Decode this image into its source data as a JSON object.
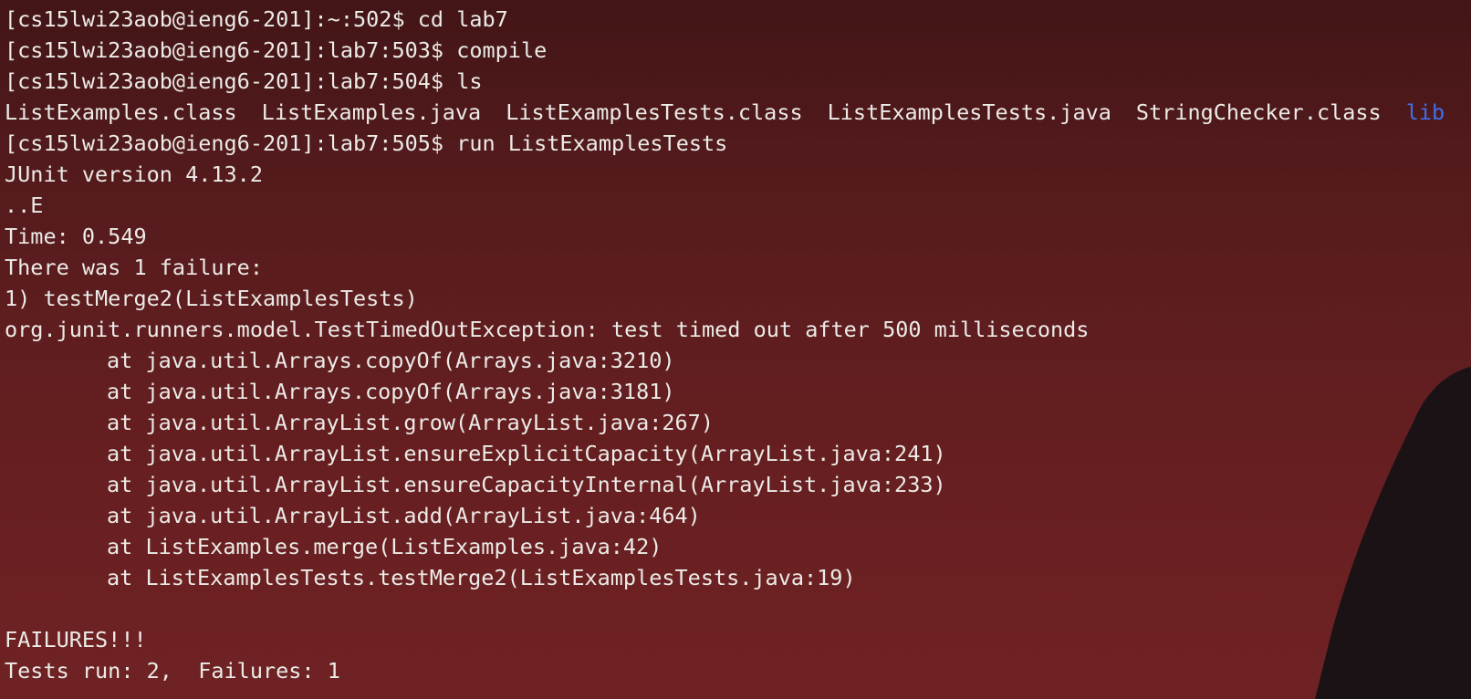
{
  "terminal": {
    "cmd1": {
      "prompt": "[cs15lwi23aob@ieng6-201]:~:502$",
      "command": "cd lab7"
    },
    "cmd2": {
      "prompt": "[cs15lwi23aob@ieng6-201]:lab7:503$",
      "command": "compile"
    },
    "cmd3": {
      "prompt": "[cs15lwi23aob@ieng6-201]:lab7:504$",
      "command": "ls"
    },
    "ls_files": [
      "ListExamples.class",
      "ListExamples.java",
      "ListExamplesTests.class",
      "ListExamplesTests.java",
      "StringChecker.class",
      "lib"
    ],
    "cmd4": {
      "prompt": "[cs15lwi23aob@ieng6-201]:lab7:505$",
      "command": "run ListExamplesTests"
    },
    "output": {
      "junit_version": "JUnit version 4.13.2",
      "progress": "..E",
      "time": "Time: 0.549",
      "failure_summary": "There was 1 failure:",
      "failure_test": "1) testMerge2(ListExamplesTests)",
      "exception": "org.junit.runners.model.TestTimedOutException: test timed out after 500 milliseconds",
      "stack": [
        "at java.util.Arrays.copyOf(Arrays.java:3210)",
        "at java.util.Arrays.copyOf(Arrays.java:3181)",
        "at java.util.ArrayList.grow(ArrayList.java:267)",
        "at java.util.ArrayList.ensureExplicitCapacity(ArrayList.java:241)",
        "at java.util.ArrayList.ensureCapacityInternal(ArrayList.java:233)",
        "at java.util.ArrayList.add(ArrayList.java:464)",
        "at ListExamples.merge(ListExamples.java:42)",
        "at ListExamplesTests.testMerge2(ListExamplesTests.java:19)"
      ],
      "failures_banner": "FAILURES!!!",
      "tests_result": "Tests run: 2,  Failures: 1"
    }
  },
  "colors": {
    "text": "#ecebe7",
    "directory": "#3f6ff0",
    "background_top": "#431516",
    "background_bottom": "#6f2224",
    "silhouette": "#1a1214"
  }
}
